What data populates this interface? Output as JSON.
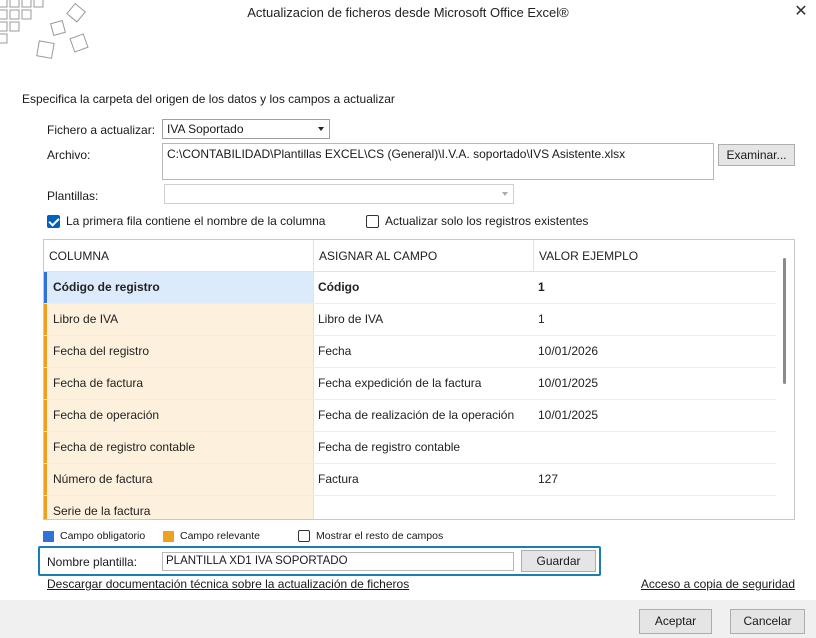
{
  "window": {
    "title": "Actualizacion de ficheros desde Microsoft Office Excel®",
    "close_glyph": "✕"
  },
  "instruction": "Especifica la carpeta del origen de los datos y los campos a actualizar",
  "form": {
    "fichero_label": "Fichero a actualizar:",
    "fichero_value": "IVA Soportado",
    "archivo_label": "Archivo:",
    "archivo_value": "C:\\CONTABILIDAD\\Plantillas EXCEL\\CS (General)\\I.V.A. soportado\\IVS Asistente.xlsx",
    "examinar_label": "Examinar...",
    "plantillas_label": "Plantillas:",
    "plantillas_value": ""
  },
  "options": {
    "primera_fila_label": "La primera fila contiene el nombre de la columna",
    "primera_fila_checked": true,
    "solo_existentes_label": "Actualizar solo los registros existentes",
    "solo_existentes_checked": false
  },
  "grid": {
    "headers": [
      "COLUMNA",
      "ASIGNAR AL CAMPO",
      "VALOR EJEMPLO"
    ],
    "rows": [
      {
        "columna": "Código de registro",
        "campo": "Código",
        "valor": "1",
        "type": "required"
      },
      {
        "columna": "Libro de IVA",
        "campo": "Libro de IVA",
        "valor": "1",
        "type": "relevant"
      },
      {
        "columna": "Fecha del registro",
        "campo": "Fecha",
        "valor": "10/01/2026",
        "type": "relevant"
      },
      {
        "columna": "Fecha de factura",
        "campo": "Fecha expedición de la factura",
        "valor": "10/01/2025",
        "type": "relevant"
      },
      {
        "columna": "Fecha de operación",
        "campo": "Fecha de realización de la operación",
        "valor": "10/01/2025",
        "type": "relevant"
      },
      {
        "columna": "Fecha de registro contable",
        "campo": "Fecha de registro contable",
        "valor": "",
        "type": "relevant"
      },
      {
        "columna": "Número de factura",
        "campo": "Factura",
        "valor": "127",
        "type": "relevant"
      },
      {
        "columna": "Serie de la factura",
        "campo": "",
        "valor": "",
        "type": "relevant"
      }
    ]
  },
  "legend": {
    "obligatorio_label": "Campo obligatorio",
    "relevante_label": "Campo relevante",
    "mostrar_label": "Mostrar el resto de campos",
    "mostrar_checked": false
  },
  "plantilla": {
    "label": "Nombre plantilla:",
    "value": "PLANTILLA XD1 IVA SOPORTADO",
    "guardar_label": "Guardar"
  },
  "links": {
    "documentacion": "Descargar documentación técnica sobre la actualización de ficheros",
    "copia": "Acceso a copia de seguridad"
  },
  "footer": {
    "aceptar_label": "Aceptar",
    "cancelar_label": "Cancelar"
  },
  "colors": {
    "required_fill": "#dcebfc",
    "required_accent": "#2f73d9",
    "relevant_fill": "#fdf0dc",
    "relevant_accent": "#f0a020",
    "checkbox_blue": "#0060c0",
    "plantilla_border": "#1a7fb0"
  },
  "icons": {
    "logo": "grid-squares-logo",
    "close": "close-icon",
    "dropdown": "chevron-down-icon",
    "checkbox": "checkbox-icon"
  }
}
